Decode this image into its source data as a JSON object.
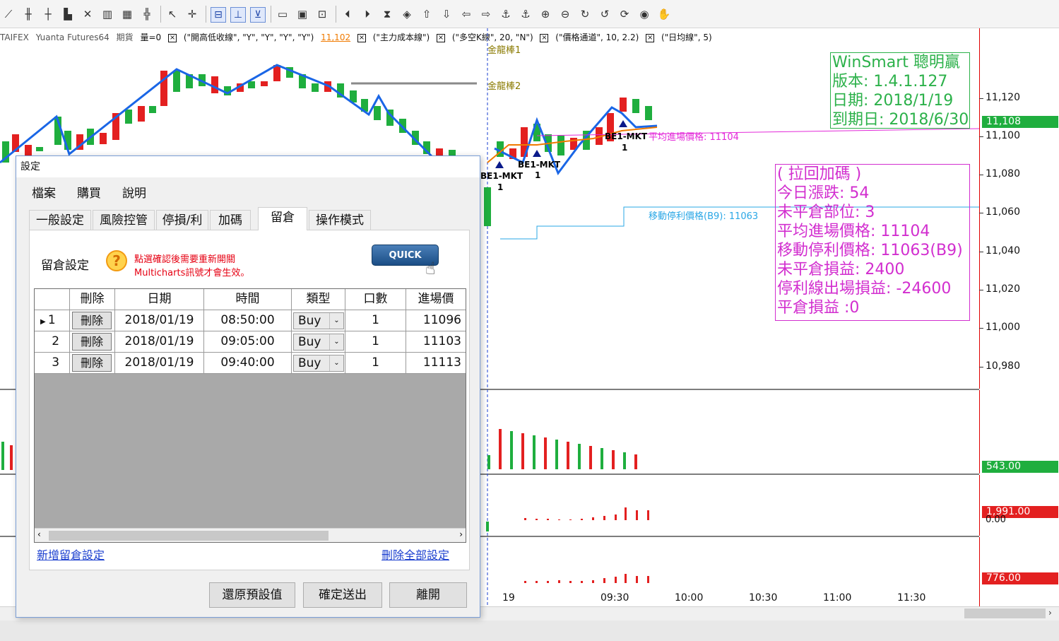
{
  "toolbar": {
    "icons": [
      "line-drawing-icon",
      "bar-chart-icon",
      "candlestick-icon",
      "histogram-icon",
      "xo-chart-icon",
      "column-chart-icon",
      "grid-chart-icon",
      "indicator-icon",
      "pointer-icon",
      "crosshair-icon",
      "zoom-box-icon",
      "down-arrow-icon",
      "up-down-icon",
      "window-icon",
      "image-icon",
      "screenshot-icon",
      "play-back-icon",
      "play-fwd-icon",
      "hourglass-icon",
      "diamond-icon",
      "up-arrow-icon",
      "down-marker-icon",
      "left-arrow-icon",
      "right-arrow-icon",
      "anchor-icon",
      "anchor2-icon",
      "zoom-in-icon",
      "zoom-out-icon",
      "refresh-icon",
      "rotate-icon",
      "rotate2-icon",
      "eye-icon",
      "hand-icon"
    ]
  },
  "indicators": {
    "symbol": "TAIFEX",
    "broker": "Yuanta Futures64",
    "market": "期貨",
    "volume": "量=0",
    "ind1": "(\"開高低收線\", \"Y\", \"Y\", \"Y\", \"Y\")",
    "ind1_value": "11,102",
    "ind2": "(\"主力成本線\")",
    "ind3": "(\"多空K線\", 20, \"N\")",
    "ind4": "(\"價格通道\", 10, 2.2)",
    "ind5": "(\"日均線\", 5)",
    "x_mark": "×"
  },
  "chart_text": {
    "label_top": "金龍棒1",
    "label_2": "金龍棒2",
    "be1": "BE1-MKT",
    "be1_qty": "1",
    "avg_entry": "平均進場價格: 11104",
    "trail_stop": "移動停利價格(B9): 11063"
  },
  "info_green": {
    "line1": "WinSmart 聰明贏",
    "line2": "版本: 1.4.1.127",
    "line3": "日期: 2018/1/19",
    "line4": "到期日: 2018/6/30"
  },
  "info_magenta": {
    "line1": "( 拉回加碼 )",
    "line2": "今日漲跌: 54",
    "line3": "未平倉部位: 3",
    "line4": "平均進場價格: 11104",
    "line5": "移動停利價格: 11063(B9)",
    "line6": "未平倉損益: 2400",
    "line7": "停利線出場損益: -24600",
    "line8": "平倉損益 :0"
  },
  "axis": {
    "labels": [
      "11,120",
      "11,100",
      "11,080",
      "11,060",
      "11,040",
      "11,020",
      "11,000",
      "10,980"
    ],
    "price_tag": "11,108",
    "vol_tag": "543.00",
    "tag2": "1,991.00",
    "tag2_under": "0.00",
    "tag3": "776.00"
  },
  "time_axis": [
    "19",
    "09:30",
    "10:00",
    "10:30",
    "11:00",
    "11:30"
  ],
  "colors": {
    "up": "#e32020",
    "down": "#1fae3e",
    "line": "#1a66e6",
    "magenta": "#e329d9",
    "cyan": "#2aa7e6"
  },
  "dialog": {
    "title": "設定",
    "menu": [
      "檔案",
      "購買",
      "說明"
    ],
    "tabs": [
      "一般設定",
      "風險控管",
      "停損/利",
      "加碼",
      "留倉",
      "操作模式"
    ],
    "group_label": "留倉設定",
    "help_icon": "?",
    "notice_line1": "點選確認後需要重新開關",
    "notice_line2": "Multicharts訊號才會生效。",
    "quick_start": "QUICK START",
    "columns": [
      "刪除",
      "日期",
      "時間",
      "類型",
      "口數",
      "進場價"
    ],
    "rows": [
      {
        "idx": "1",
        "del": "刪除",
        "date": "2018/01/19",
        "time": "08:50:00",
        "type": "Buy",
        "qty": "1",
        "price": "11096"
      },
      {
        "idx": "2",
        "del": "刪除",
        "date": "2018/01/19",
        "time": "09:05:00",
        "type": "Buy",
        "qty": "1",
        "price": "11103"
      },
      {
        "idx": "3",
        "del": "刪除",
        "date": "2018/01/19",
        "time": "09:40:00",
        "type": "Buy",
        "qty": "1",
        "price": "11113"
      }
    ],
    "add_link": "新增留倉設定",
    "delete_all_link": "刪除全部設定",
    "btn_reset": "還原預設值",
    "btn_confirm": "確定送出",
    "btn_leave": "離開"
  }
}
